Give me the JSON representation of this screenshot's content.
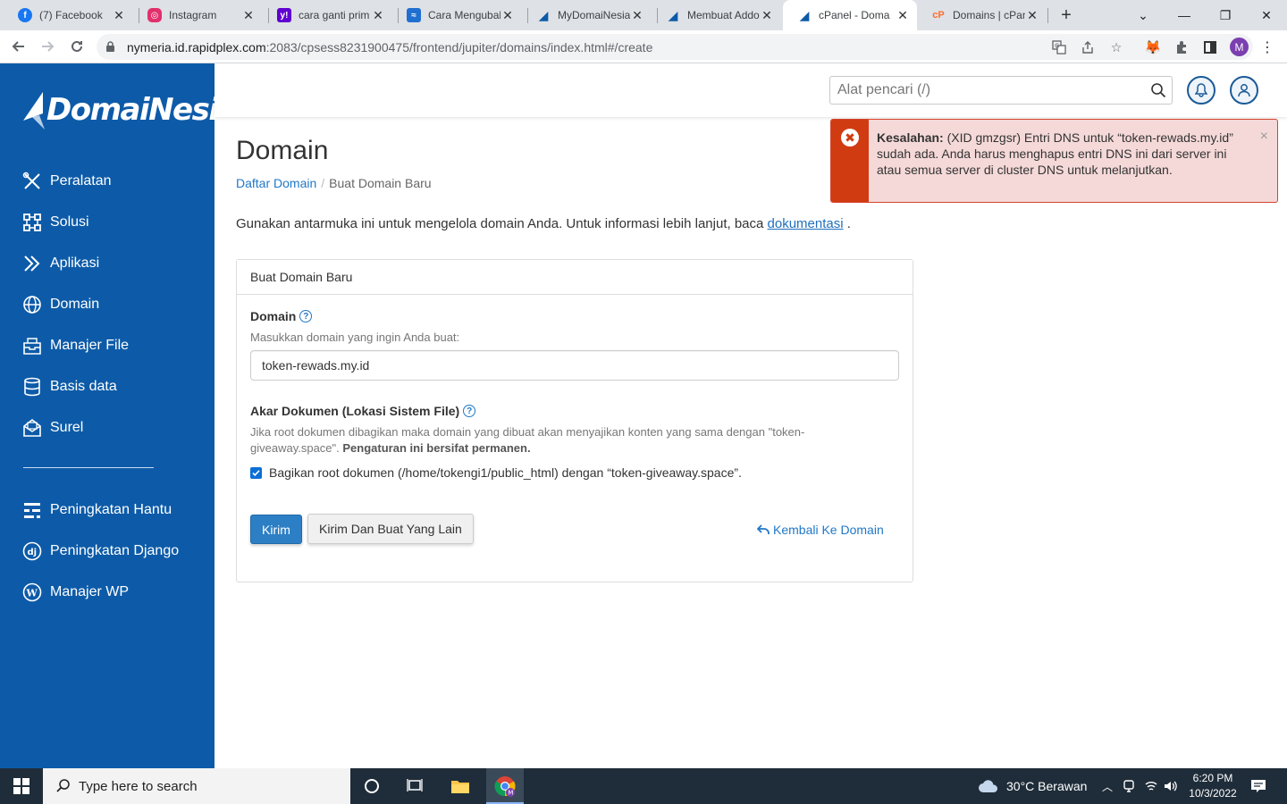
{
  "browser": {
    "tabs": [
      {
        "title": "(7) Facebook",
        "icon": "facebook-icon",
        "color": "#1877f2"
      },
      {
        "title": "Instagram",
        "icon": "instagram-icon",
        "color": "#e1306c"
      },
      {
        "title": "cara ganti prim",
        "icon": "yahoo-icon",
        "color": "#5f01d1"
      },
      {
        "title": "Cara Mengubah",
        "icon": "site-icon",
        "color": "#1f6fd1"
      },
      {
        "title": "MyDomaiNesia",
        "icon": "domainesia-icon",
        "color": "#0d5ba8"
      },
      {
        "title": "Membuat Addo",
        "icon": "domainesia-icon",
        "color": "#0d5ba8"
      },
      {
        "title": "cPanel - Doma",
        "icon": "domainesia-icon",
        "color": "#0d5ba8"
      },
      {
        "title": "Domains | cPan",
        "icon": "cpanel-icon",
        "color": "#ff6c2c"
      }
    ],
    "active_tab": 6,
    "url_host": "nymeria.id.rapidplex.com",
    "url_path": ":2083/cpsess8231900475/frontend/jupiter/domains/index.html#/create",
    "profile_initial": "M"
  },
  "sidebar": {
    "logo": "DomaiNesia",
    "items": [
      {
        "label": "Peralatan",
        "icon": "tools-icon"
      },
      {
        "label": "Solusi",
        "icon": "solutions-icon"
      },
      {
        "label": "Aplikasi",
        "icon": "applications-icon"
      },
      {
        "label": "Domain",
        "icon": "globe-icon"
      },
      {
        "label": "Manajer File",
        "icon": "file-manager-icon"
      },
      {
        "label": "Basis data",
        "icon": "database-icon"
      },
      {
        "label": "Surel",
        "icon": "email-icon"
      }
    ],
    "secondary_items": [
      {
        "label": "Peningkatan Hantu",
        "icon": "ghost-icon"
      },
      {
        "label": "Peningkatan Django",
        "icon": "django-icon"
      },
      {
        "label": "Manajer WP",
        "icon": "wordpress-icon"
      }
    ],
    "bg_color": "#0d5ba8"
  },
  "header": {
    "search_placeholder": "Alat pencari (/)"
  },
  "page": {
    "title": "Domain",
    "breadcrumb": {
      "parent": "Daftar Domain",
      "current": "Buat Domain Baru"
    },
    "intro_text": "Gunakan antarmuka ini untuk mengelola domain Anda. Untuk informasi lebih lanjut, baca ",
    "intro_link": "dokumentasi",
    "intro_end": " ."
  },
  "form": {
    "panel_title": "Buat Domain Baru",
    "domain_label": "Domain",
    "domain_help": "Masukkan domain yang ingin Anda buat:",
    "domain_value": "token-rewads.my.id",
    "docroot_label": "Akar Dokumen (Lokasi Sistem File)",
    "docroot_help_1": "Jika root dokumen dibagikan maka domain yang dibuat akan menyajikan konten yang sama dengan \"token-",
    "docroot_help_2": "giveaway.space\". ",
    "docroot_help_bold": "Pengaturan ini bersifat permanen.",
    "share_checkbox_label": "Bagikan root dokumen (/home/tokengi1/public_html) dengan “token-giveaway.space”.",
    "share_checked": true,
    "submit_label": "Kirim",
    "submit_another_label": "Kirim Dan Buat Yang Lain",
    "back_label": "Kembali Ke Domain"
  },
  "notice": {
    "type": "error",
    "bold": "Kesalahan:",
    "message": " (XID gmzgsr) Entri DNS untuk “token-rewads.my.id” sudah ada. Anda harus menghapus entri DNS ini dari server ini atau semua server di cluster DNS untuk melanjutkan.",
    "color": "#d13b12"
  },
  "taskbar": {
    "search_placeholder": "Type here to search",
    "weather": "30°C  Berawan",
    "time": "6:20 PM",
    "date": "10/3/2022"
  }
}
